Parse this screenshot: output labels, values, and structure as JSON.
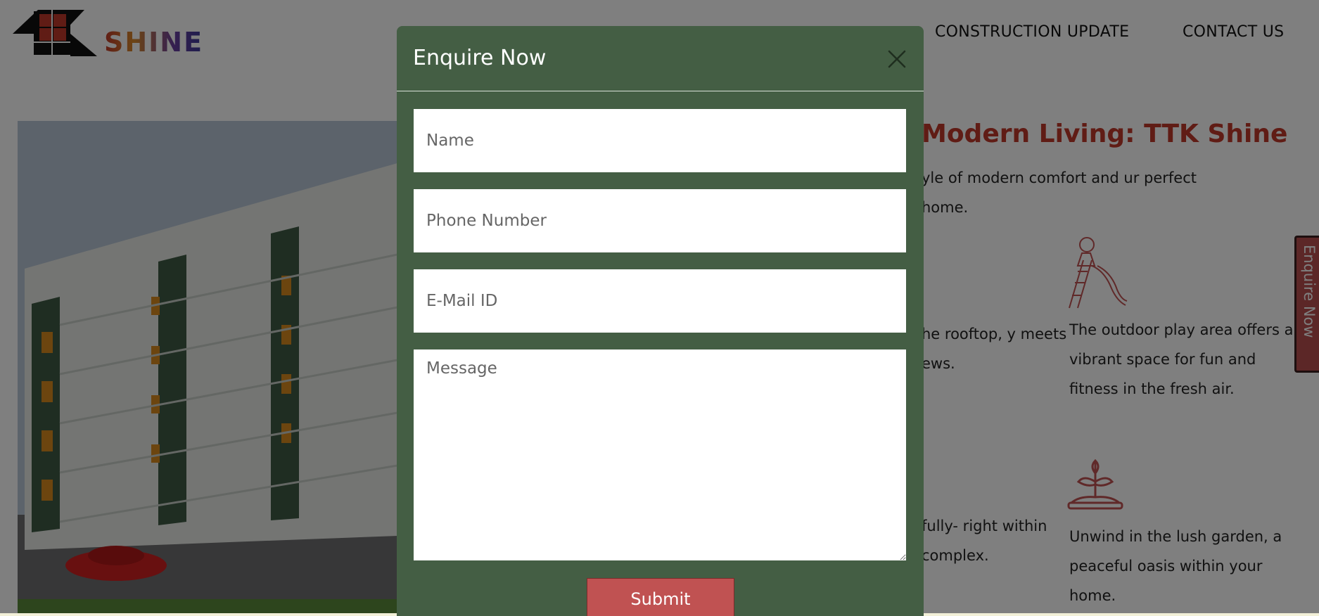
{
  "brand": {
    "name": "SHINE"
  },
  "nav": {
    "construction_update": "CONSTRUCTION UPDATE",
    "contact_us": "CONTACT US"
  },
  "hero": {
    "headline": "Modern Living: TTK Shine",
    "intro": "yle of modern comfort and ur perfect home."
  },
  "amenities": {
    "rooftop": "he rooftop, y meets ews.",
    "play_area": "The outdoor play area offers a vibrant space for fun and fitness in the fresh air.",
    "gym": "fully- right within complex.",
    "garden": "Unwind in the lush garden, a peaceful oasis within your home."
  },
  "side_tab": {
    "label": "Enquire Now"
  },
  "modal": {
    "title": "Enquire Now",
    "name_placeholder": "Name",
    "phone_placeholder": "Phone Number",
    "email_placeholder": "E-Mail ID",
    "message_placeholder": "Message",
    "submit_label": "Submit"
  },
  "colors": {
    "modal_bg": "#445e44",
    "accent_red": "#c0392b",
    "submit_bg": "#c05252"
  }
}
